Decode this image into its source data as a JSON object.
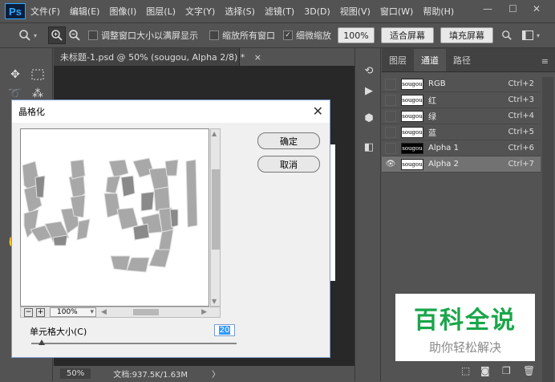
{
  "app": {
    "logo": "Ps"
  },
  "menu": [
    "文件(F)",
    "编辑(E)",
    "图像(I)",
    "图层(L)",
    "文字(Y)",
    "选择(S)",
    "滤镜(T)",
    "3D(D)",
    "视图(V)",
    "窗口(W)",
    "帮助(H)"
  ],
  "window_controls": {
    "minimize": "—",
    "maximize": "☐",
    "close": "✕"
  },
  "options": {
    "resize_windows": "调整窗口大小以满屏显示",
    "zoom_all": "缩放所有窗口",
    "scrubby": "细微缩放",
    "zoom_pct": "100%",
    "fit_screen": "适合屏幕",
    "fill_screen": "填充屏幕"
  },
  "document": {
    "tab_title": "未标题-1.psd @ 50% (sougou, Alpha 2/8) *",
    "tab_close": "×"
  },
  "status": {
    "zoom": "50%",
    "doc_info": "文档:937.5K/1.63M",
    "arrow": "〉"
  },
  "panel": {
    "tabs": [
      "图层",
      "通道",
      "路径"
    ],
    "channels": [
      {
        "name": "RGB",
        "key": "Ctrl+2",
        "thumb": "sougou"
      },
      {
        "name": "红",
        "key": "Ctrl+3",
        "thumb": "sougou"
      },
      {
        "name": "绿",
        "key": "Ctrl+4",
        "thumb": "sougou"
      },
      {
        "name": "蓝",
        "key": "Ctrl+5",
        "thumb": "sougou"
      },
      {
        "name": "Alpha 1",
        "key": "Ctrl+6",
        "thumb": "sougou"
      },
      {
        "name": "Alpha 2",
        "key": "Ctrl+7",
        "thumb": "sougou"
      }
    ]
  },
  "dialog": {
    "title": "晶格化",
    "ok": "确定",
    "cancel": "取消",
    "zoom": "100%",
    "zoom_out": "−",
    "zoom_in": "+",
    "cell_size_label": "单元格大小(C)",
    "cell_size_value": "20",
    "preview_text": "ug"
  },
  "watermark": {
    "title": "百科全说",
    "subtitle": "助你轻松解决"
  }
}
